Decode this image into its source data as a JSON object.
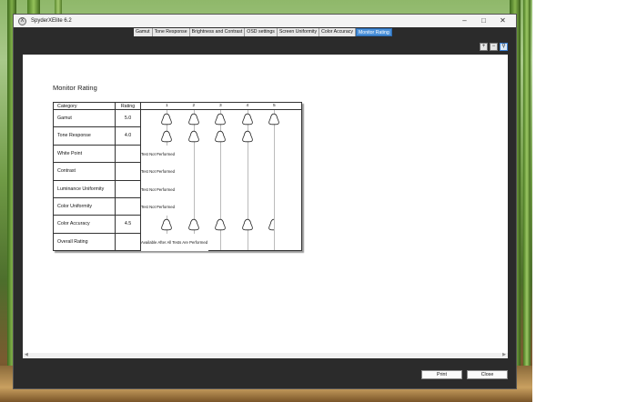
{
  "window": {
    "title": "SpyderXElite 6.2",
    "app_icon": "X"
  },
  "tabs": [
    {
      "label": "Gamut",
      "active": false
    },
    {
      "label": "Tone Response",
      "active": false
    },
    {
      "label": "Brightness and Contrast",
      "active": false
    },
    {
      "label": "OSD settings",
      "active": false
    },
    {
      "label": "Screen Uniformity",
      "active": false
    },
    {
      "label": "Color Accuracy",
      "active": false
    },
    {
      "label": "Monitor Rating",
      "active": true
    }
  ],
  "zoom_icons": [
    "zoom-in-icon",
    "zoom-out-icon",
    "zoom-fit-icon"
  ],
  "report": {
    "title": "Monitor Rating",
    "headers": {
      "category": "Category",
      "rating": "Rating"
    },
    "scale": [
      "1",
      "2",
      "3",
      "4",
      "5"
    ],
    "rows": [
      {
        "category": "Gamut",
        "rating": "5.0",
        "score": 5.0,
        "note": ""
      },
      {
        "category": "Tone Response",
        "rating": "4.0",
        "score": 4.0,
        "note": ""
      },
      {
        "category": "White Point",
        "rating": "",
        "score": null,
        "note": "Test Not Performed"
      },
      {
        "category": "Contrast",
        "rating": "",
        "score": null,
        "note": "Test Not Performed"
      },
      {
        "category": "Luminance Uniformity",
        "rating": "",
        "score": null,
        "note": "Test Not Performed"
      },
      {
        "category": "Color Uniformity",
        "rating": "",
        "score": null,
        "note": "Test Not Performed"
      },
      {
        "category": "Color Accuracy",
        "rating": "4.5",
        "score": 4.5,
        "note": ""
      },
      {
        "category": "Overall Rating",
        "rating": "",
        "score": null,
        "note": "Available After All Tests Are Performed"
      }
    ]
  },
  "buttons": {
    "print": "Print",
    "close": "Close"
  },
  "colors": {
    "accent": "#4a90d9",
    "frame": "#2b2b2b"
  }
}
